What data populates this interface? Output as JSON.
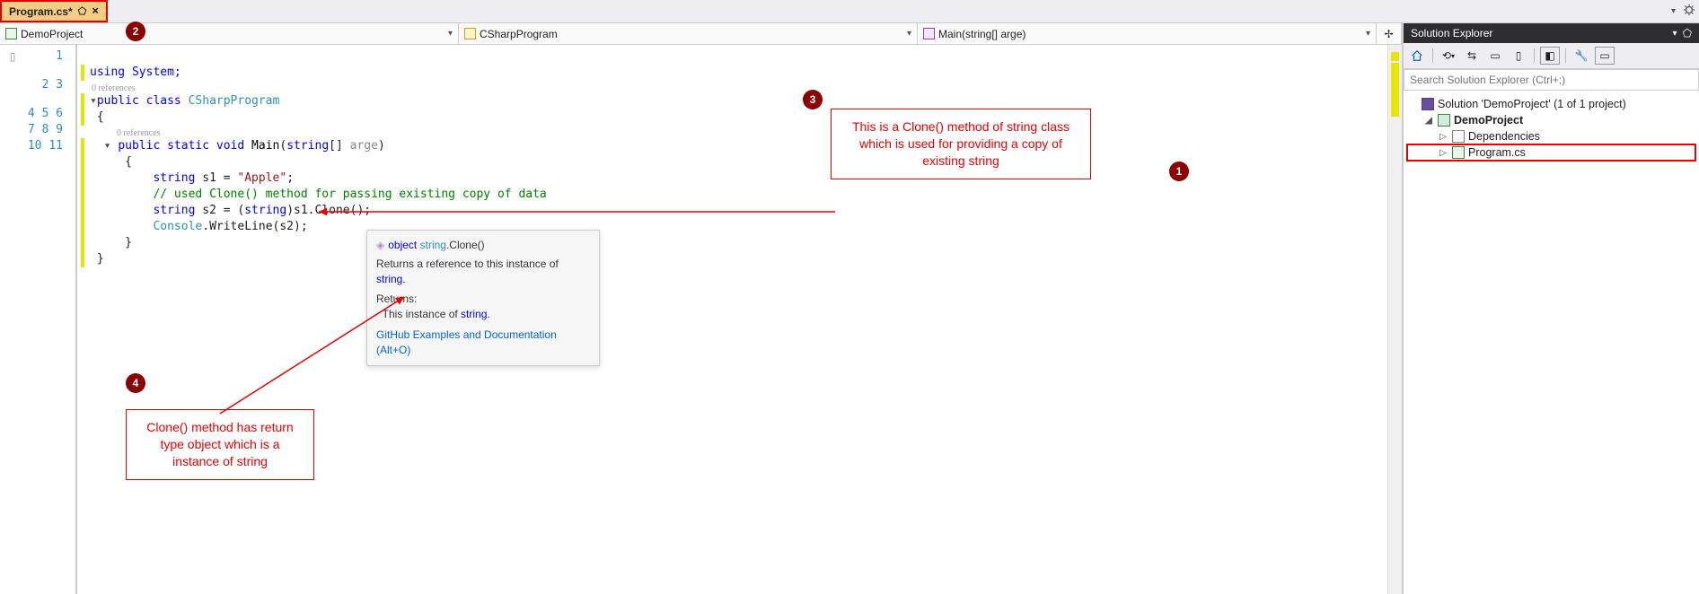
{
  "tab": {
    "title": "Program.cs*",
    "pinned_tooltip": "Toggle pin status",
    "close_tooltip": "Close"
  },
  "tabbar": {
    "dropdown_hint": "▾"
  },
  "nav": {
    "project": "DemoProject",
    "class": "CSharpProgram",
    "member": "Main(string[] arge)"
  },
  "code": {
    "refs_text": "0 references",
    "lines": {
      "l1": "using System;",
      "l2a": "public",
      "l2b": "class",
      "l2c": "CSharpProgram",
      "l3": "{",
      "l4a": "public",
      "l4b": "static",
      "l4c": "void",
      "l4d": "Main",
      "l4e": "string",
      "l4f": "arge",
      "l5": "{",
      "l6a": "string",
      "l6b": "s1 = ",
      "l6c": "\"Apple\"",
      "l6d": ";",
      "l7": "// used Clone() method for passing existing copy of data",
      "l8a": "string",
      "l8b": "s2 = (",
      "l8c": "string",
      "l8d": ")s1.Clone();",
      "l9a": "Console",
      "l9b": ".WriteLine(s2);",
      "l10": "}",
      "l11": "}"
    }
  },
  "tooltip": {
    "sig_pre": "object",
    "sig_type": "string",
    "sig_method": ".Clone()",
    "desc1": "Returns a reference to this instance of ",
    "desc1_type": "string",
    "desc1_end": ".",
    "returns_label": "Returns:",
    "returns_text": "This instance of ",
    "returns_type": "string",
    "returns_end": ".",
    "link": "GitHub Examples and Documentation (Alt+O)"
  },
  "callouts": {
    "c3": "This is a Clone() method of string class which is used for providing a copy of existing string",
    "c4": "Clone() method has return type object which is a instance of string"
  },
  "solution": {
    "title": "Solution Explorer",
    "search_placeholder": "Search Solution Explorer (Ctrl+;)",
    "root": "Solution 'DemoProject' (1 of 1 project)",
    "proj": "DemoProject",
    "dep": "Dependencies",
    "file": "Program.cs"
  },
  "badges": {
    "b1": "1",
    "b2": "2",
    "b3": "3",
    "b4": "4"
  }
}
